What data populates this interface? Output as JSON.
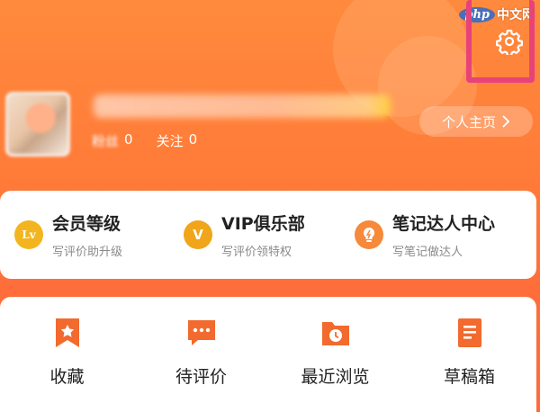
{
  "watermark": {
    "logo": "php",
    "text": "中文网"
  },
  "header": {
    "settings_icon": "gear-icon",
    "stats": [
      {
        "label": "粉丝",
        "value": "0"
      },
      {
        "label": "关注",
        "value": "0"
      }
    ],
    "profile_button": {
      "label": "个人主页",
      "icon": "chevron-right-icon"
    }
  },
  "member_section": {
    "items": [
      {
        "title": "会员等级",
        "subtitle": "写评价助升级",
        "badge": "Lv",
        "color": "#f3b51f"
      },
      {
        "title": "VIP俱乐部",
        "subtitle": "写评价领特权",
        "badge": "V",
        "color": "#f0a51a"
      },
      {
        "title": "笔记达人中心",
        "subtitle": "写笔记做达人",
        "badge": "bulb",
        "color": "#f7893a"
      }
    ]
  },
  "functions": {
    "items": [
      {
        "label": "收藏",
        "icon": "bookmark-star-icon"
      },
      {
        "label": "待评价",
        "icon": "chat-bubble-icon"
      },
      {
        "label": "最近浏览",
        "icon": "folder-clock-icon"
      },
      {
        "label": "草稿箱",
        "icon": "draft-icon"
      }
    ]
  },
  "colors": {
    "accent": "#ff7a38",
    "highlight": "#e8427a",
    "icon_orange": "#f26a2e"
  }
}
